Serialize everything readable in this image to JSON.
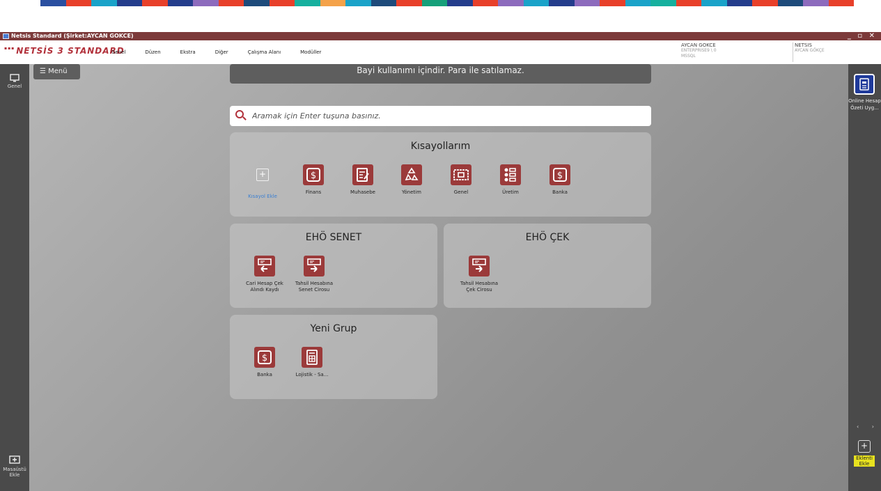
{
  "window": {
    "title": "Netsis Standard (Şirket:AYCAN GOKCE)",
    "controls": "_ ▫ ✕"
  },
  "logo": {
    "prefix": "logo",
    "text": "NETSİS 3 STANDARD"
  },
  "menu": [
    "Genel",
    "Düzen",
    "Ekstra",
    "Diğer",
    "Çalışma Alanı",
    "Modüller"
  ],
  "user_info": {
    "name": "AYCAN GOKCE",
    "server": "ENTERPRISE9 \\ 0",
    "db": "MSSQL",
    "product": "NETSIS",
    "company": "AYCAN GÖKÇE"
  },
  "left_sidebar": {
    "genel": "Genel",
    "masaustu": "Masaüstü Ekle"
  },
  "right_sidebar": {
    "online": "Online Hesap Özeti Uyg...",
    "eklenti": "Eklenti Ekle"
  },
  "menu_button": "Menü",
  "banner": "Bayi kullanımı içindir. Para ile satılamaz.",
  "search": {
    "placeholder": "Aramak için Enter tuşuna basınız."
  },
  "shortcuts": {
    "title": "Kısayollarım",
    "add": "Kısayol Ekle",
    "items": [
      "Finans",
      "Muhasebe",
      "Yönetim",
      "Genel",
      "Üretim",
      "Banka"
    ]
  },
  "senet": {
    "title": "EHÖ SENET",
    "items": [
      "Cari Hesap Çek Alındı Kaydı",
      "Tahsil Hesabına Senet Cirosu"
    ]
  },
  "cek": {
    "title": "EHÖ ÇEK",
    "items": [
      "Tahsil Hesabına Çek Cirosu"
    ]
  },
  "yeni_grup": {
    "title": "Yeni Grup",
    "items": [
      "Banka",
      "Lojistik - Sa..."
    ]
  },
  "colors": {
    "accent": "#9b3a3a",
    "titlebar": "#7c3a3a",
    "brand": "#b2313b"
  }
}
